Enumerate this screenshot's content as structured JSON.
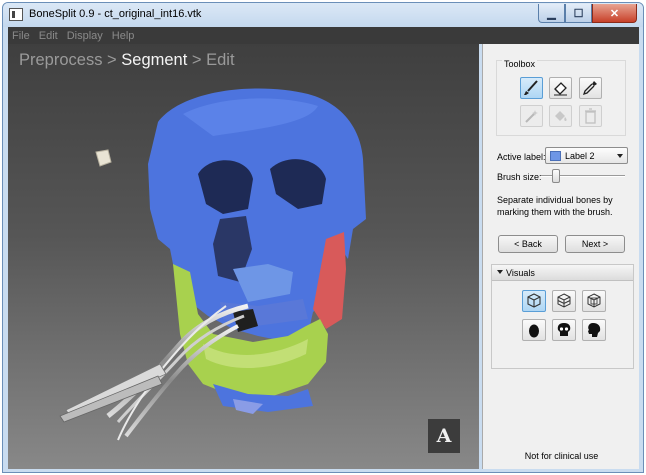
{
  "window": {
    "title": "BoneSplit 0.9 - ct_original_int16.vtk",
    "controls": {
      "minimize": "▁",
      "maximize": "☐",
      "close": "✕"
    }
  },
  "menu": [
    "File",
    "Edit",
    "Display",
    "Help"
  ],
  "breadcrumb": {
    "step1": "Preprocess",
    "sep1": " > ",
    "step2": "Segment",
    "sep2": " > ",
    "step3": "Edit"
  },
  "viewport": {
    "orientation_marker": "A"
  },
  "toolbox": {
    "title": "Toolbox",
    "tools": [
      {
        "icon": "brush-icon",
        "active": true,
        "enabled": true
      },
      {
        "icon": "eraser-icon",
        "active": false,
        "enabled": true
      },
      {
        "icon": "eyedropper-icon",
        "active": false,
        "enabled": true
      },
      {
        "icon": "magic-wand-icon",
        "active": false,
        "enabled": false
      },
      {
        "icon": "paint-bucket-icon",
        "active": false,
        "enabled": false
      },
      {
        "icon": "trash-icon",
        "active": false,
        "enabled": false
      }
    ]
  },
  "label_selector": {
    "label": "Active label:",
    "value": "Label 2",
    "swatch_color": "#6e96e6"
  },
  "brush": {
    "label": "Brush size:",
    "value_fraction": 0.15
  },
  "instructions": "Separate individual bones by marking them with the brush.",
  "nav": {
    "back": "< Back",
    "next": "Next >"
  },
  "visuals": {
    "title": "Visuals",
    "render_buttons": [
      {
        "icon": "solid-cube-icon",
        "active": true
      },
      {
        "icon": "wireframe-cube-icon",
        "active": false
      },
      {
        "icon": "transparent-cube-icon",
        "active": false
      },
      {
        "icon": "egg-shape-icon",
        "active": false
      },
      {
        "icon": "skull-icon",
        "active": false
      },
      {
        "icon": "head-silhouette-icon",
        "active": false
      }
    ]
  },
  "footer": "Not for clinical use",
  "colors": {
    "label1": "#4d74de",
    "label2": "#6e96e6",
    "label3": "#a8d14e",
    "label4": "#d85a5a",
    "accent": "#5a9ed6"
  }
}
